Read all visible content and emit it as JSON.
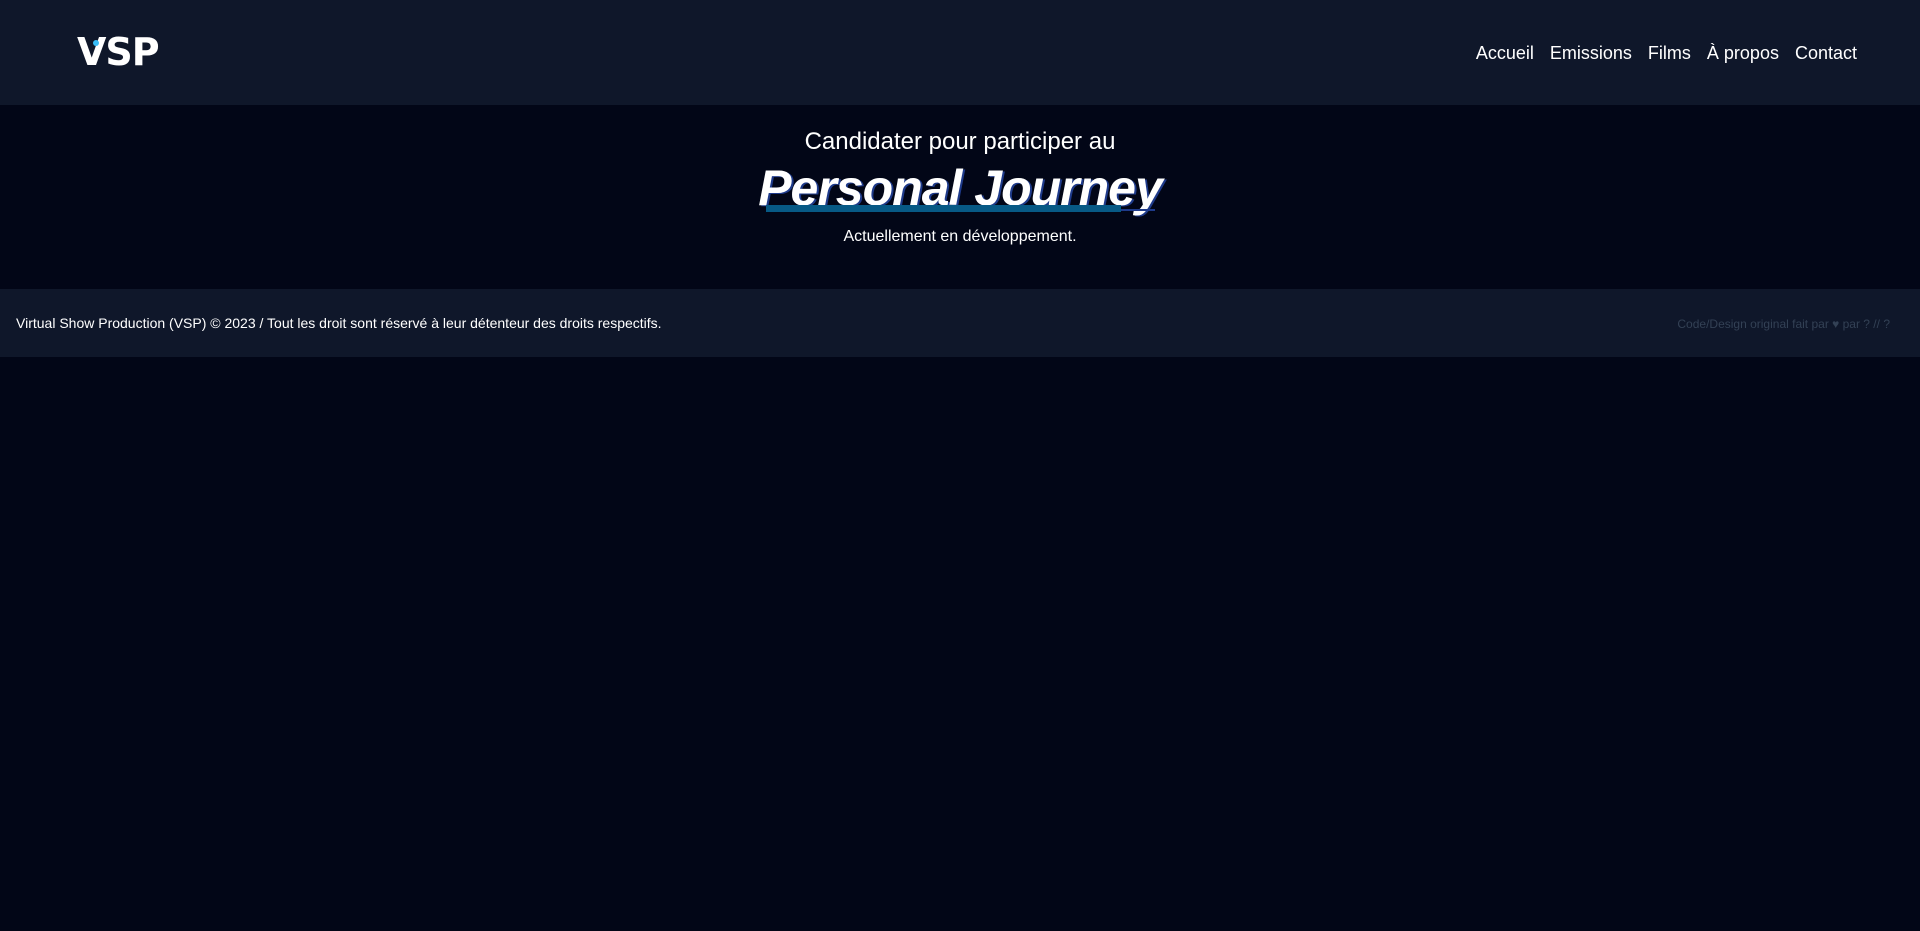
{
  "header": {
    "logo": {
      "letter_v": "V",
      "letters_sp": "SP"
    },
    "nav": [
      {
        "label": "Accueil"
      },
      {
        "label": "Emissions"
      },
      {
        "label": "Films"
      },
      {
        "label": "À propos"
      },
      {
        "label": "Contact"
      }
    ]
  },
  "hero": {
    "subtitle": "Candidater pour participer au",
    "title": "Personal Journey",
    "note": "Actuellement en développement."
  },
  "footer": {
    "copyright": "Virtual Show Production (VSP) © 2023 / Tout les droit sont réservé à leur détenteur des droits respectifs.",
    "credit_prefix": "Code/Design original fait par",
    "heart_icon": "heart-icon",
    "heart_glyph": "♥",
    "credit_suffix": "par ? // ?"
  },
  "colors": {
    "page_bg": "#020617",
    "header_bg": "#0f172a",
    "accent": "#38bdf8",
    "underline": "#075985"
  }
}
